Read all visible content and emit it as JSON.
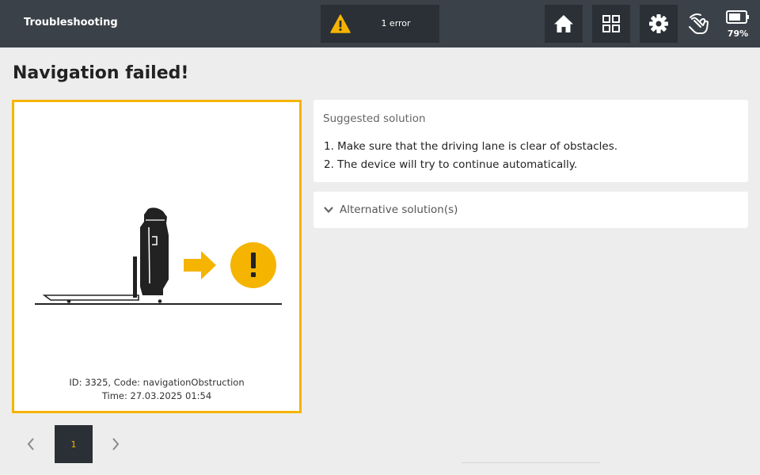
{
  "header": {
    "title": "Troubleshooting",
    "error_summary": "1 error",
    "battery_level": "79%"
  },
  "page": {
    "title": "Navigation failed!"
  },
  "error_card": {
    "id_line": "ID: 3325, Code: navigationObstruction",
    "time_line": "Time: 27.03.2025 01:54"
  },
  "pagination": {
    "current_page": "1"
  },
  "solution": {
    "title": "Suggested solution",
    "steps": [
      "1. Make sure that the driving lane is clear of obstacles.",
      "2. The device will try to continue automatically."
    ]
  },
  "alternative": {
    "label": "Alternative solution(s)"
  },
  "colors": {
    "accent": "#f5b400",
    "topbar": "#3b4148",
    "button_dark": "#2b3036",
    "background": "#ededed"
  },
  "icons": {
    "warning": "warning-triangle-icon",
    "home": "home-icon",
    "grid": "grid-icon",
    "settings": "gear-icon",
    "hand": "hand-touch-icon",
    "battery": "battery-icon",
    "prev": "chevron-left-icon",
    "next": "chevron-right-icon",
    "expand": "chevron-down-icon"
  }
}
